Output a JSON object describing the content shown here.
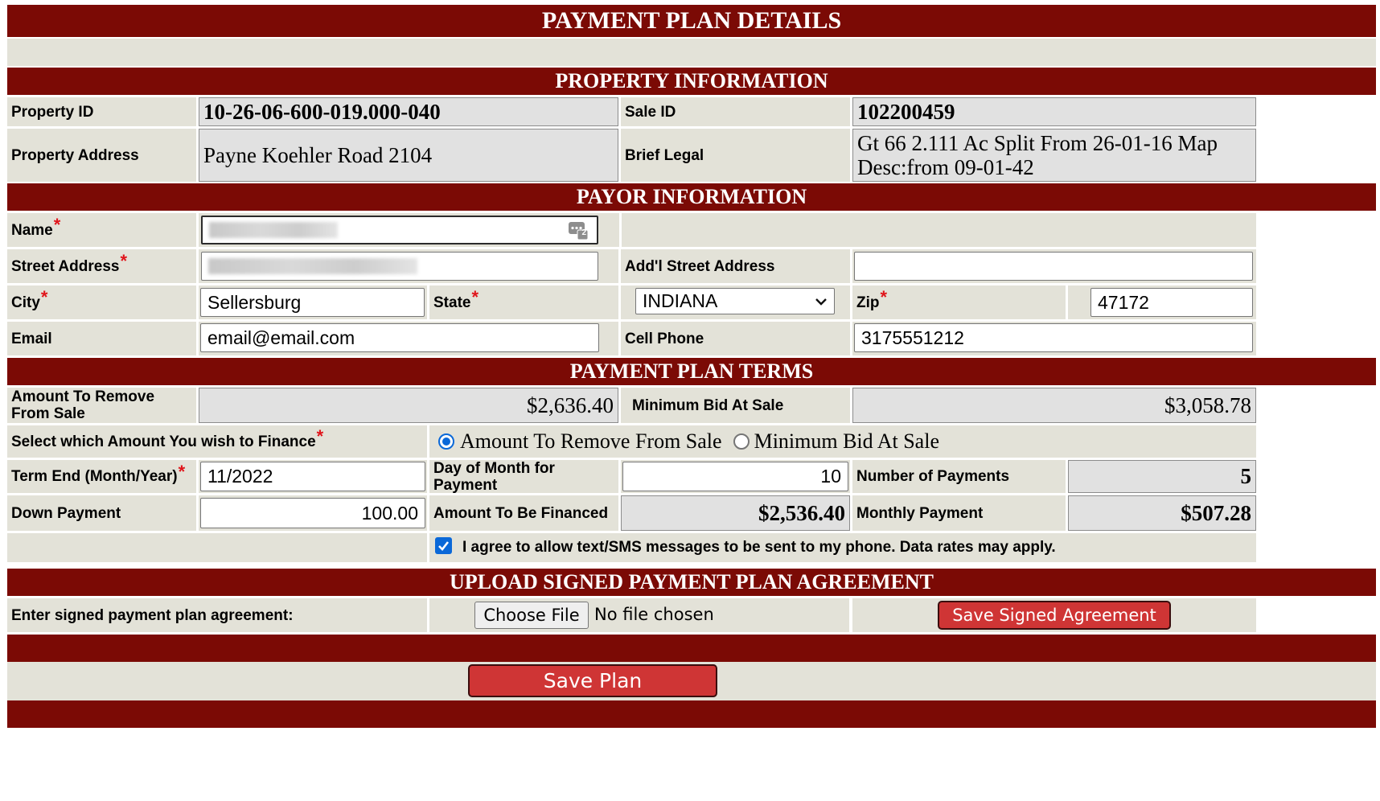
{
  "header": {
    "title": "PAYMENT PLAN DETAILS"
  },
  "property": {
    "section_title": "PROPERTY INFORMATION",
    "property_id_label": "Property ID",
    "property_id": "10-26-06-600-019.000-040",
    "sale_id_label": "Sale ID",
    "sale_id": "102200459",
    "address_label": "Property Address",
    "address": "Payne Koehler Road 2104",
    "brief_legal_label": "Brief Legal",
    "brief_legal_line1": "Gt 66 2.111 Ac Split From 26-01-16 Map",
    "brief_legal_line2": "Desc:from 09-01-42"
  },
  "payor": {
    "section_title": "PAYOR INFORMATION",
    "name_label": "Name",
    "street_label": "Street Address",
    "addl_street_label": "Add'l Street Address",
    "addl_street_value": "",
    "city_label": "City",
    "city_value": "Sellersburg",
    "state_label": "State",
    "state_value": "INDIANA",
    "zip_label": "Zip",
    "zip_value": "47172",
    "email_label": "Email",
    "email_value": "email@email.com",
    "cell_label": "Cell Phone",
    "cell_value": "3175551212",
    "autofill_badge": "2"
  },
  "terms": {
    "section_title": "PAYMENT PLAN TERMS",
    "remove_label": "Amount To Remove From Sale",
    "remove_value": "$2,636.40",
    "min_bid_label": "Minimum Bid At Sale",
    "min_bid_value": "$3,058.78",
    "finance_label": "Select which Amount You wish to Finance",
    "option_remove": "Amount To Remove From Sale",
    "option_min_bid": "Minimum Bid At Sale",
    "term_end_label": "Term End (Month/Year)",
    "term_end_value": "11/2022",
    "day_label": "Day of Month for Payment",
    "day_value": "10",
    "num_payments_label": "Number of Payments",
    "num_payments_value": "5",
    "down_label": "Down Payment",
    "down_value": "100.00",
    "financed_label": "Amount To Be Financed",
    "financed_value": "$2,536.40",
    "monthly_label": "Monthly Payment",
    "monthly_value": "$507.28",
    "sms_text": "I agree to allow text/SMS messages to be sent to my phone. Data rates may apply.",
    "sms_checked": true
  },
  "upload": {
    "section_title": "UPLOAD SIGNED PAYMENT PLAN AGREEMENT",
    "prompt": "Enter signed payment plan agreement:",
    "choose_file": "Choose File",
    "no_file": "No file chosen",
    "save_signed": "Save Signed Agreement"
  },
  "actions": {
    "save_plan": "Save Plan"
  },
  "colors": {
    "band": "#7b0a05",
    "cell": "#e3e2d8",
    "button": "#cf3535",
    "required": "#e0151b",
    "accent": "#0a68d8"
  }
}
